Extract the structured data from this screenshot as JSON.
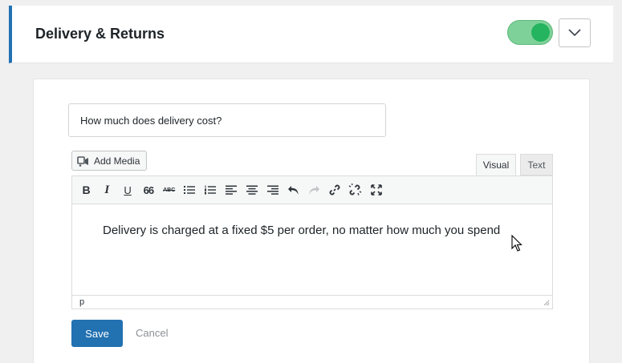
{
  "header": {
    "title": "Delivery & Returns",
    "toggle_on": true
  },
  "form": {
    "question_value": "How much does delivery cost?",
    "add_media_label": "Add Media",
    "tabs": [
      {
        "label": "Visual",
        "active": true
      },
      {
        "label": "Text",
        "active": false
      }
    ],
    "toolbar": [
      {
        "name": "bold-icon",
        "glyph": "B"
      },
      {
        "name": "italic-icon",
        "glyph": "I"
      },
      {
        "name": "underline-icon",
        "glyph": "U"
      },
      {
        "name": "blockquote-icon",
        "glyph": "66"
      },
      {
        "name": "strikethrough-icon",
        "glyph": "ABC"
      },
      {
        "name": "bullet-list-icon",
        "glyph": ""
      },
      {
        "name": "numbered-list-icon",
        "glyph": ""
      },
      {
        "name": "align-left-icon",
        "glyph": ""
      },
      {
        "name": "align-center-icon",
        "glyph": ""
      },
      {
        "name": "align-right-icon",
        "glyph": ""
      },
      {
        "name": "undo-icon",
        "glyph": ""
      },
      {
        "name": "redo-icon",
        "glyph": ""
      },
      {
        "name": "link-icon",
        "glyph": ""
      },
      {
        "name": "unlink-icon",
        "glyph": ""
      },
      {
        "name": "fullscreen-icon",
        "glyph": ""
      }
    ],
    "answer_text": "Delivery is charged at a fixed $5 per order, no matter how much you spend",
    "path_label": "p",
    "save_label": "Save",
    "cancel_label": "Cancel"
  },
  "colors": {
    "accent": "#2271b1",
    "toggle_track": "#7fd19a",
    "toggle_knob": "#24b35e"
  }
}
